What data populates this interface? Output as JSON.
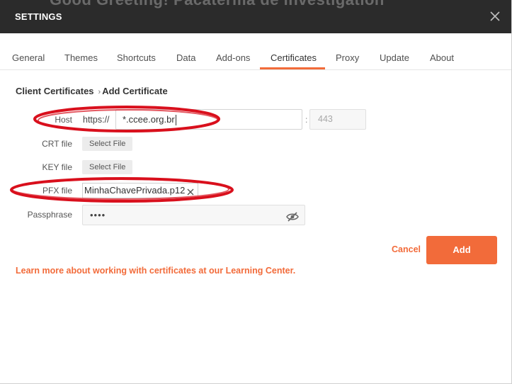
{
  "background_text": "Good Greeting! Pacaterma de investigation",
  "header": {
    "title": "SETTINGS"
  },
  "tabs": [
    {
      "label": "General"
    },
    {
      "label": "Themes"
    },
    {
      "label": "Shortcuts"
    },
    {
      "label": "Data"
    },
    {
      "label": "Add-ons"
    },
    {
      "label": "Certificates",
      "active": true
    },
    {
      "label": "Proxy"
    },
    {
      "label": "Update"
    },
    {
      "label": "About"
    }
  ],
  "breadcrumb": {
    "parent": "Client Certificates",
    "separator": "›",
    "current": "Add Certificate"
  },
  "form": {
    "host_label": "Host",
    "host_prefix": "https://",
    "host_value": "*.ccee.org.br",
    "port_separator": ":",
    "port_placeholder": "443",
    "crt_label": "CRT file",
    "crt_button": "Select File",
    "key_label": "KEY file",
    "key_button": "Select File",
    "pfx_label": "PFX file",
    "pfx_value": "MinhaChavePrivada.p12",
    "passphrase_label": "Passphrase",
    "passphrase_value": "••••"
  },
  "actions": {
    "cancel": "Cancel",
    "add": "Add"
  },
  "learn_more": "Learn more about working with certificates at our Learning Center.",
  "colors": {
    "accent": "#f26b3a",
    "header_bg": "#2b2b2b",
    "annotation": "#d9101d"
  }
}
